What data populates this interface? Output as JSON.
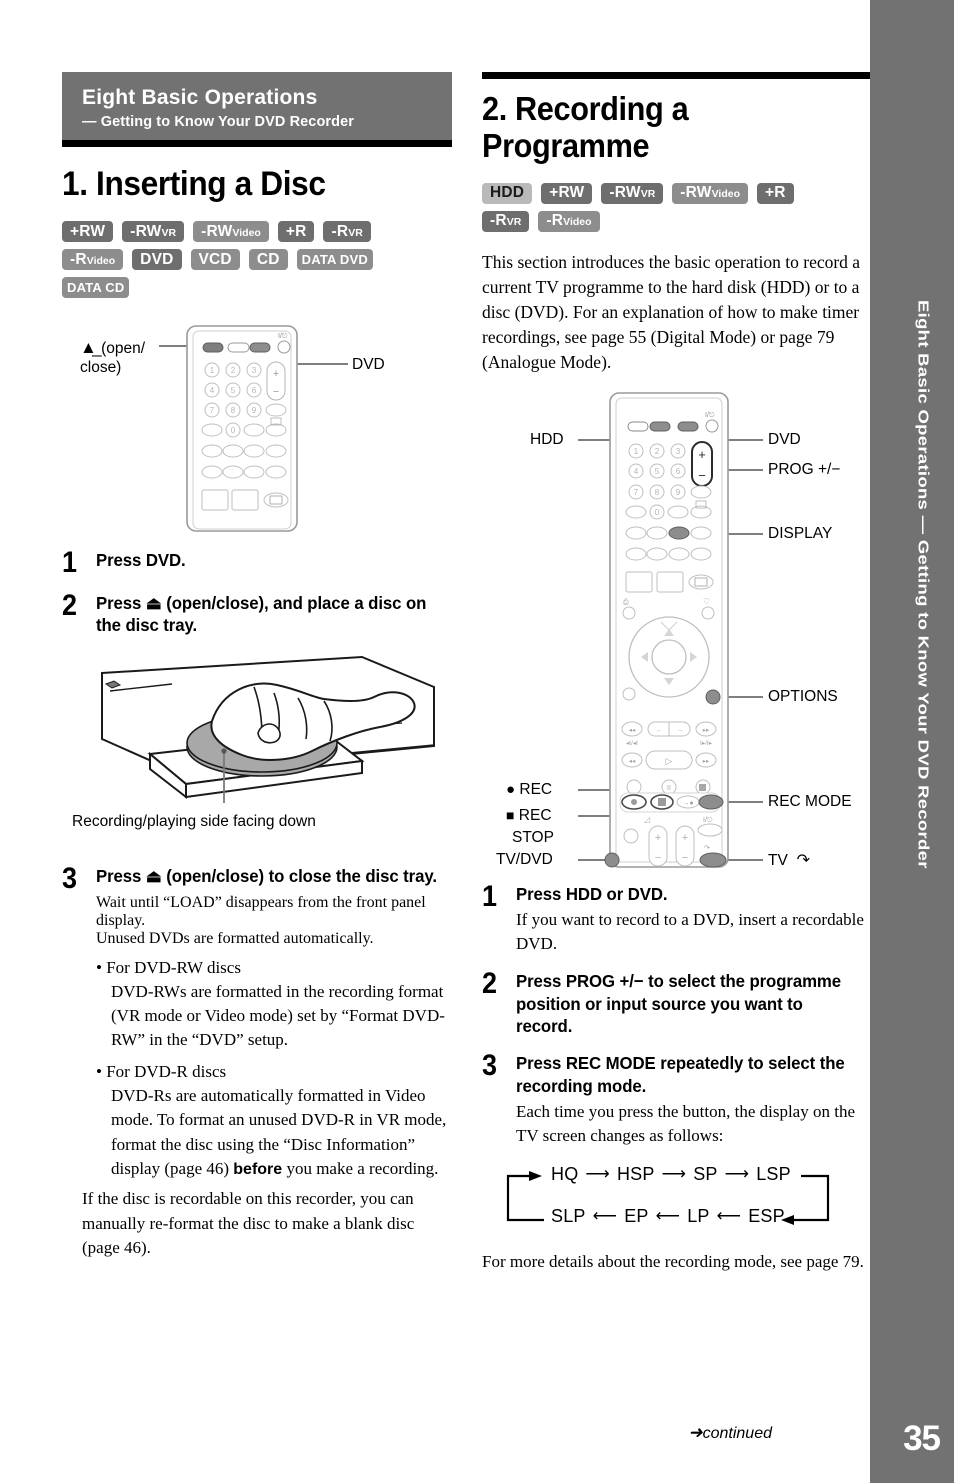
{
  "side_tab": {
    "label": "Eight Basic Operations — Getting to Know Your DVD Recorder"
  },
  "colors": {
    "banner_gray": "#727272",
    "badge_dark": "#6e6e6e",
    "badge_mid": "#8d8d8d",
    "badge_light": "#b9b9b9"
  },
  "left": {
    "banner": {
      "line1": "Eight Basic Operations",
      "line2": "— Getting to Know Your DVD Recorder"
    },
    "title": "1. Inserting a Disc",
    "badges": [
      {
        "text": "+RW",
        "tone": "dark"
      },
      {
        "text": "-RW",
        "sub": "VR",
        "tone": "dark"
      },
      {
        "text": "-RW",
        "sub": "Video",
        "tone": "mid"
      },
      {
        "text": "+R",
        "tone": "dark"
      },
      {
        "text": "-R",
        "sub": "VR",
        "tone": "dark"
      },
      {
        "text": "-R",
        "sub": "Video",
        "tone": "mid"
      },
      {
        "text": "DVD",
        "tone": "dark"
      },
      {
        "text": "VCD",
        "tone": "mid"
      },
      {
        "text": "CD",
        "tone": "mid"
      },
      {
        "text": "DATA DVD",
        "tone": "mid",
        "narrow": true
      },
      {
        "text": "DATA CD",
        "tone": "mid",
        "narrow": true
      }
    ],
    "remote_callouts": {
      "open_close": "(open/",
      "open_close2": "close)",
      "dvd": "DVD"
    },
    "steps": [
      {
        "num": "1",
        "head": "Press DVD."
      },
      {
        "num": "2",
        "head": "Press ⏏ (open/close), and place a disc on the disc tray."
      },
      {
        "num": "3",
        "head": "Press ⏏ (open/close) to close the disc tray."
      }
    ],
    "illustration_caption": "Recording/playing side facing down",
    "step3_paras": [
      "Wait until “LOAD” disappears from the front panel display.",
      "Unused DVDs are formatted automatically."
    ],
    "bullets": [
      {
        "title": "For DVD-RW discs",
        "body": "DVD-RWs are formatted in the recording format (VR mode or Video mode) set by “Format DVD-RW” in the “DVD” setup."
      },
      {
        "title": "For DVD-R discs",
        "body_a": "DVD-Rs are automatically formatted in Video mode. To format an unused DVD-R in VR mode, format the disc using the “Disc Information” display (page 46) ",
        "body_bold": "before",
        "body_b": " you make a recording."
      }
    ],
    "closing": "If the disc is recordable on this recorder, you can manually re-format the disc to make a blank disc (page 46)."
  },
  "right": {
    "title": "2. Recording a Programme",
    "badges": [
      {
        "text": "HDD",
        "tone": "light"
      },
      {
        "text": "+RW",
        "tone": "dark"
      },
      {
        "text": "-RW",
        "sub": "VR",
        "tone": "dark"
      },
      {
        "text": "-RW",
        "sub": "Video",
        "tone": "mid"
      },
      {
        "text": "+R",
        "tone": "dark"
      },
      {
        "text": "-R",
        "sub": "VR",
        "tone": "dark"
      },
      {
        "text": "-R",
        "sub": "Video",
        "tone": "mid"
      }
    ],
    "intro": "This section introduces the basic operation to record a current TV programme to the hard disk (HDD) or to a disc (DVD). For an explanation of how to make timer recordings, see page 55 (Digital Mode) or page 79 (Analogue Mode).",
    "remote_callouts": {
      "hdd": "HDD",
      "dvd": "DVD",
      "prog": "PROG +/−",
      "display": "DISPLAY",
      "options": "OPTIONS",
      "rec": "REC",
      "rec_stop": "REC",
      "rec_stop2": "STOP",
      "tv_dvd": "TV/DVD",
      "rec_mode": "REC MODE",
      "tv": "TV"
    },
    "steps": [
      {
        "num": "1",
        "head": "Press HDD or DVD.",
        "para": "If you want to record to a DVD, insert a recordable DVD."
      },
      {
        "num": "2",
        "head": "Press PROG +/− to select the programme position or input source you want to record.",
        "para": ""
      },
      {
        "num": "3",
        "head": "Press REC MODE repeatedly to select the recording mode.",
        "para": "Each time you press the button, the display on the TV screen changes as follows:"
      }
    ],
    "cycle": {
      "top": [
        "HQ",
        "HSP",
        "SP",
        "LSP"
      ],
      "bottom": [
        "SLP",
        "EP",
        "LP",
        "ESP"
      ]
    },
    "closing": "For more details about the recording mode, see page 79."
  },
  "footer": {
    "continued": "continued",
    "page": "35"
  }
}
